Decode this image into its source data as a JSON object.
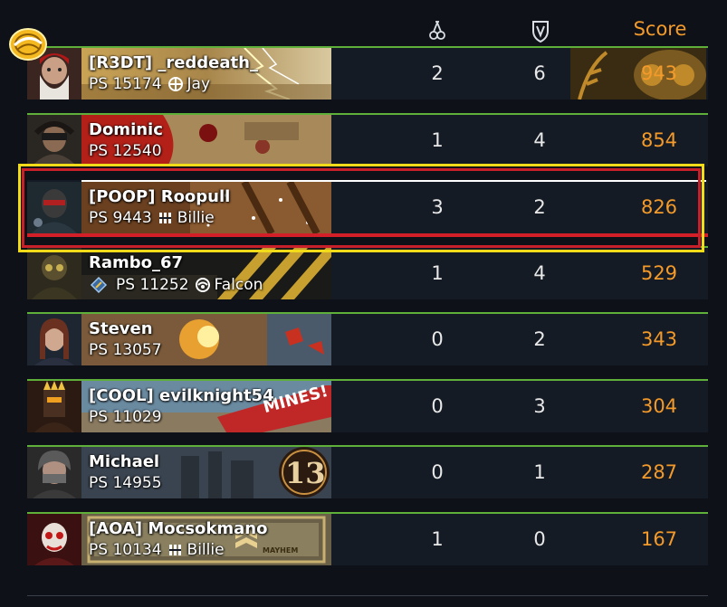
{
  "header": {
    "kills_icon": "kills-icon",
    "deaths_icon": "deaths-icon",
    "score_label": "Score"
  },
  "colors": {
    "accent_orange": "#f39a2a",
    "row_border_green": "#5fb03a",
    "highlight_yellow": "#f2dc1a",
    "highlight_red": "#c8202a"
  },
  "players": [
    {
      "name": "[R3DT] _reddeath_",
      "ps": "PS 15174",
      "class_icon": "scout-icon",
      "class_name": "Jay",
      "kills": "2",
      "deaths": "6",
      "score": "943"
    },
    {
      "name": "Dominic",
      "ps": "PS 12540",
      "class_icon": "",
      "class_name": "",
      "kills": "1",
      "deaths": "4",
      "score": "854"
    },
    {
      "name": "[POOP] Roopull",
      "ps": "PS 9443",
      "class_icon": "fortify-icon",
      "class_name": "Billie",
      "kills": "3",
      "deaths": "2",
      "score": "826"
    },
    {
      "name": "Rambo_67",
      "ps": "PS 11252",
      "class_icon": "falcon-icon",
      "class_name": "Falcon",
      "kills": "1",
      "deaths": "4",
      "score": "529"
    },
    {
      "name": "Steven",
      "ps": "PS 13057",
      "class_icon": "",
      "class_name": "",
      "kills": "0",
      "deaths": "2",
      "score": "343"
    },
    {
      "name": "[COOL] evilknight54",
      "ps": "PS 11029",
      "class_icon": "",
      "class_name": "",
      "kills": "0",
      "deaths": "3",
      "score": "304"
    },
    {
      "name": "Michael",
      "ps": "PS 14955",
      "class_icon": "",
      "class_name": "",
      "kills": "0",
      "deaths": "1",
      "score": "287"
    },
    {
      "name": "[AOA] Mocsokmano",
      "ps": "PS 10134",
      "class_icon": "fortify-icon",
      "class_name": "Billie",
      "kills": "1",
      "deaths": "0",
      "score": "167"
    }
  ],
  "banner_texts": {
    "mines": "MINES!",
    "thirteen": "13",
    "mayhem": "MAYHEM"
  }
}
